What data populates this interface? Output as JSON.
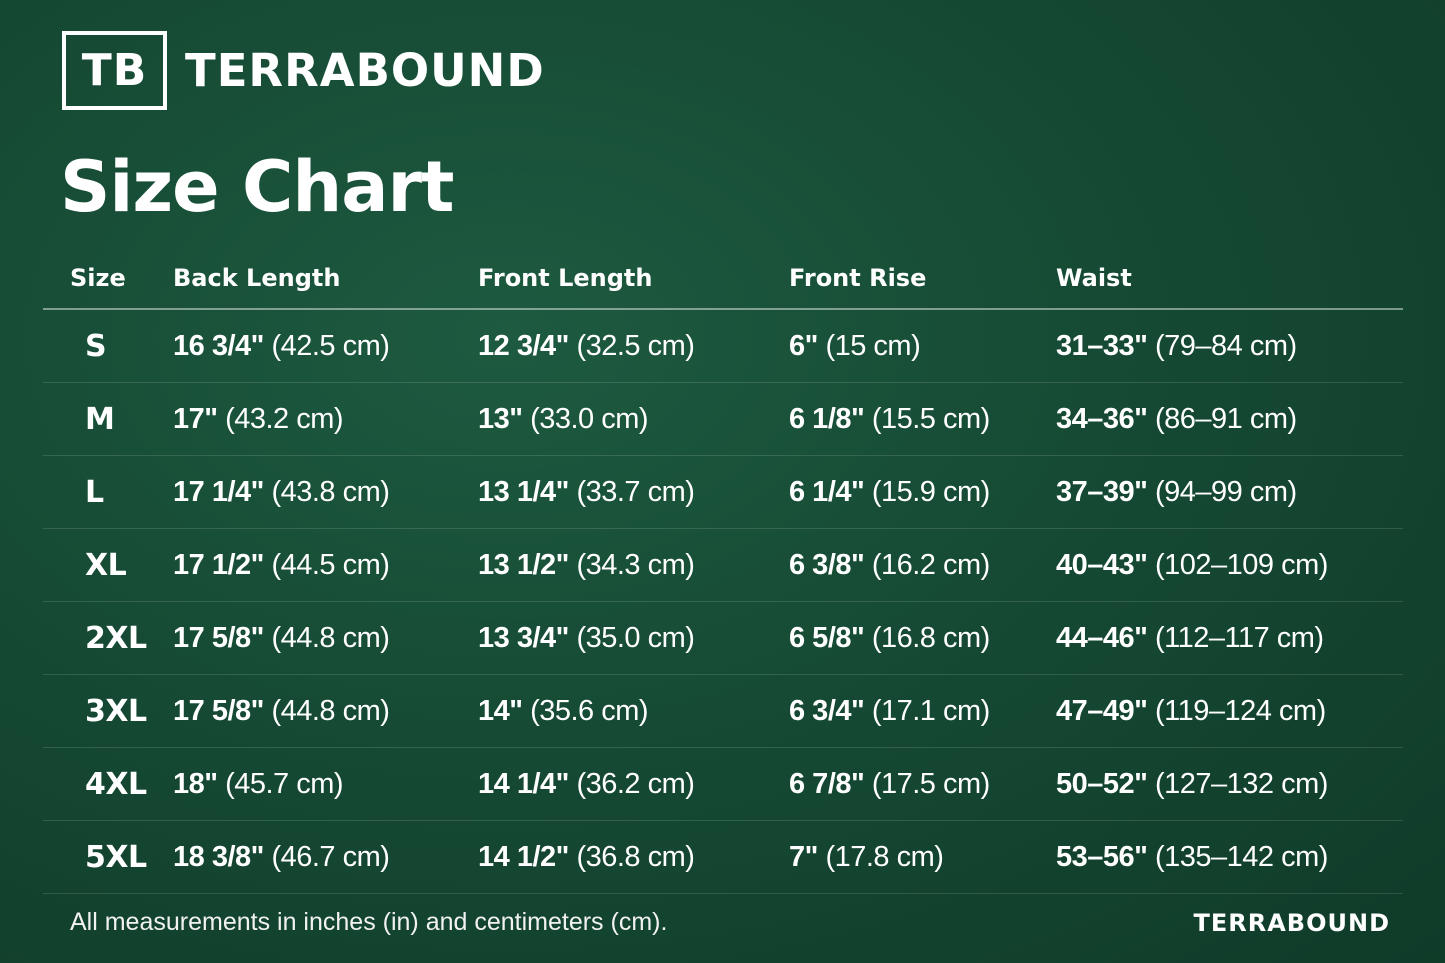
{
  "brand": {
    "logo_mark": "TB",
    "name": "TERRABOUND"
  },
  "title": "Size Chart",
  "table": {
    "headers": [
      "Size",
      "Back Length",
      "Front Length",
      "Front Rise",
      "Waist"
    ],
    "rows": [
      {
        "size": "S",
        "back_in": "16 3/4\"",
        "back_cm": "(42.5 cm)",
        "front_in": "12 3/4\"",
        "front_cm": "(32.5 cm)",
        "rise_in": "6\"",
        "rise_cm": "(15 cm)",
        "waist_in": "31–33\"",
        "waist_cm": "(79–84 cm)"
      },
      {
        "size": "M",
        "back_in": "17\"",
        "back_cm": "(43.2 cm)",
        "front_in": "13\"",
        "front_cm": "(33.0 cm)",
        "rise_in": "6 1/8\"",
        "rise_cm": "(15.5 cm)",
        "waist_in": "34–36\"",
        "waist_cm": "(86–91 cm)"
      },
      {
        "size": "L",
        "back_in": "17 1/4\"",
        "back_cm": "(43.8 cm)",
        "front_in": "13 1/4\"",
        "front_cm": "(33.7 cm)",
        "rise_in": "6 1/4\"",
        "rise_cm": "(15.9 cm)",
        "waist_in": "37–39\"",
        "waist_cm": "(94–99 cm)"
      },
      {
        "size": "XL",
        "back_in": "17 1/2\"",
        "back_cm": "(44.5 cm)",
        "front_in": "13 1/2\"",
        "front_cm": "(34.3 cm)",
        "rise_in": "6 3/8\"",
        "rise_cm": "(16.2 cm)",
        "waist_in": "40–43\"",
        "waist_cm": "(102–109 cm)"
      },
      {
        "size": "2XL",
        "back_in": "17 5/8\"",
        "back_cm": "(44.8 cm)",
        "front_in": "13 3/4\"",
        "front_cm": "(35.0 cm)",
        "rise_in": "6 5/8\"",
        "rise_cm": "(16.8 cm)",
        "waist_in": "44–46\"",
        "waist_cm": "(112–117 cm)"
      },
      {
        "size": "3XL",
        "back_in": "17 5/8\"",
        "back_cm": "(44.8 cm)",
        "front_in": "14\"",
        "front_cm": "(35.6 cm)",
        "rise_in": "6 3/4\"",
        "rise_cm": "(17.1 cm)",
        "waist_in": "47–49\"",
        "waist_cm": "(119–124 cm)"
      },
      {
        "size": "4XL",
        "back_in": "18\"",
        "back_cm": "(45.7 cm)",
        "front_in": "14 1/4\"",
        "front_cm": "(36.2 cm)",
        "rise_in": "6 7/8\"",
        "rise_cm": "(17.5 cm)",
        "waist_in": "50–52\"",
        "waist_cm": "(127–132 cm)"
      },
      {
        "size": "5XL",
        "back_in": "18 3/8\"",
        "back_cm": "(46.7 cm)",
        "front_in": "14 1/2\"",
        "front_cm": "(36.8 cm)",
        "rise_in": "7\"",
        "rise_cm": "(17.8 cm)",
        "waist_in": "53–56\"",
        "waist_cm": "(135–142 cm)"
      }
    ]
  },
  "footer": {
    "note": "All measurements in inches (in) and centimeters (cm).",
    "brand": "TERRABOUND"
  },
  "colors": {
    "background": "#164a34",
    "text": "#ffffff"
  }
}
